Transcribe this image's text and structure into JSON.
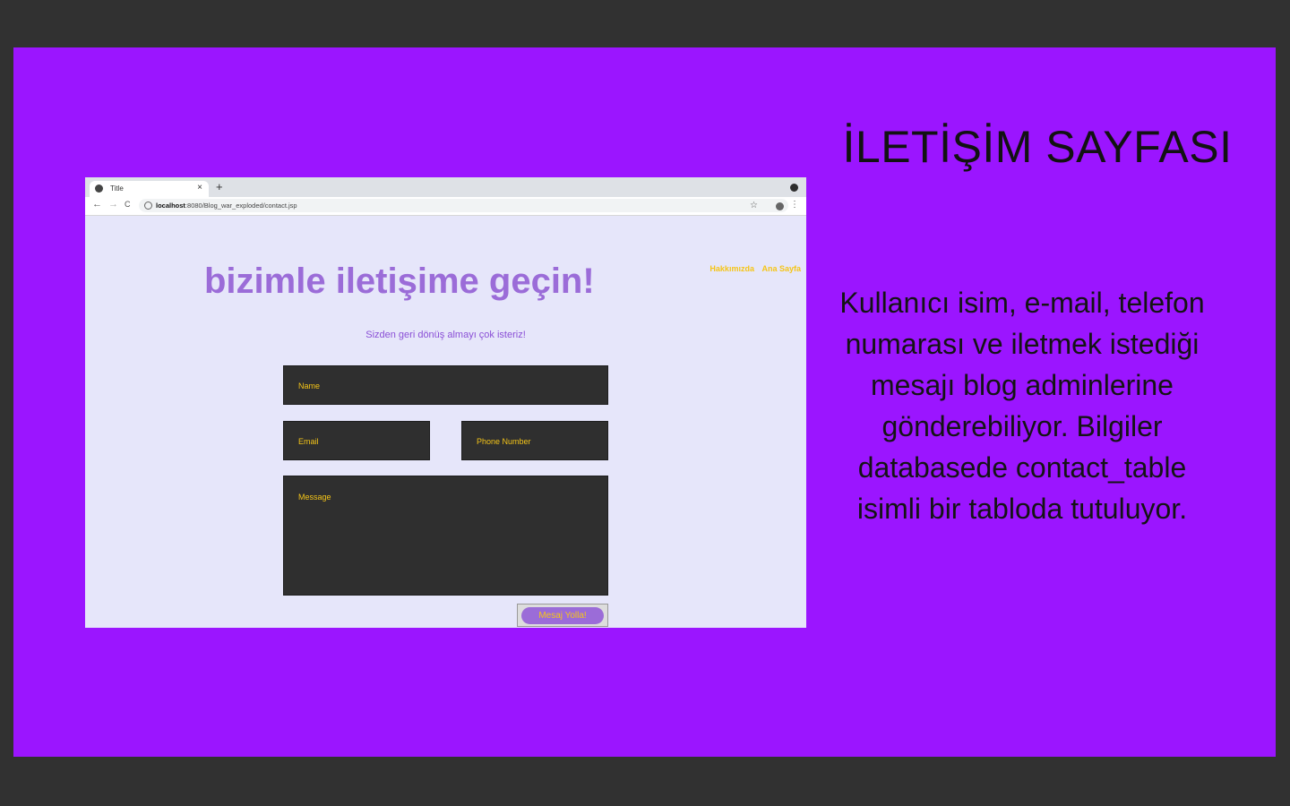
{
  "slide": {
    "title": "İLETİŞİM SAYFASI",
    "description": "Kullanıcı isim, e-mail, telefon numarası ve iletmek istediği mesajı blog adminlerine gönderebiliyor. Bilgiler databasede contact_table isimli bir tabloda tutuluyor.",
    "background_color": "#9b15ff"
  },
  "browser": {
    "tab_title": "Title",
    "tab_close": "×",
    "new_tab": "+",
    "url_host": "localhost",
    "url_rest": ":8080/Blog_war_exploded/contact.jsp",
    "back": "←",
    "forward": "→",
    "reload": "C",
    "star": "☆",
    "menu": "⋮"
  },
  "contact_page": {
    "nav": [
      "Hakkımızda",
      "Ana Sayfa"
    ],
    "heading": "bizimle iletişime geçin!",
    "subheading": "Sizden geri dönüş almayı çok isteriz!",
    "name_placeholder": "Name",
    "email_placeholder": "Email",
    "phone_placeholder": "Phone Number",
    "message_placeholder": "Message",
    "submit_label": "Mesaj Yolla!",
    "accent_color": "#9b6cd8",
    "text_color": "#f5c518"
  }
}
